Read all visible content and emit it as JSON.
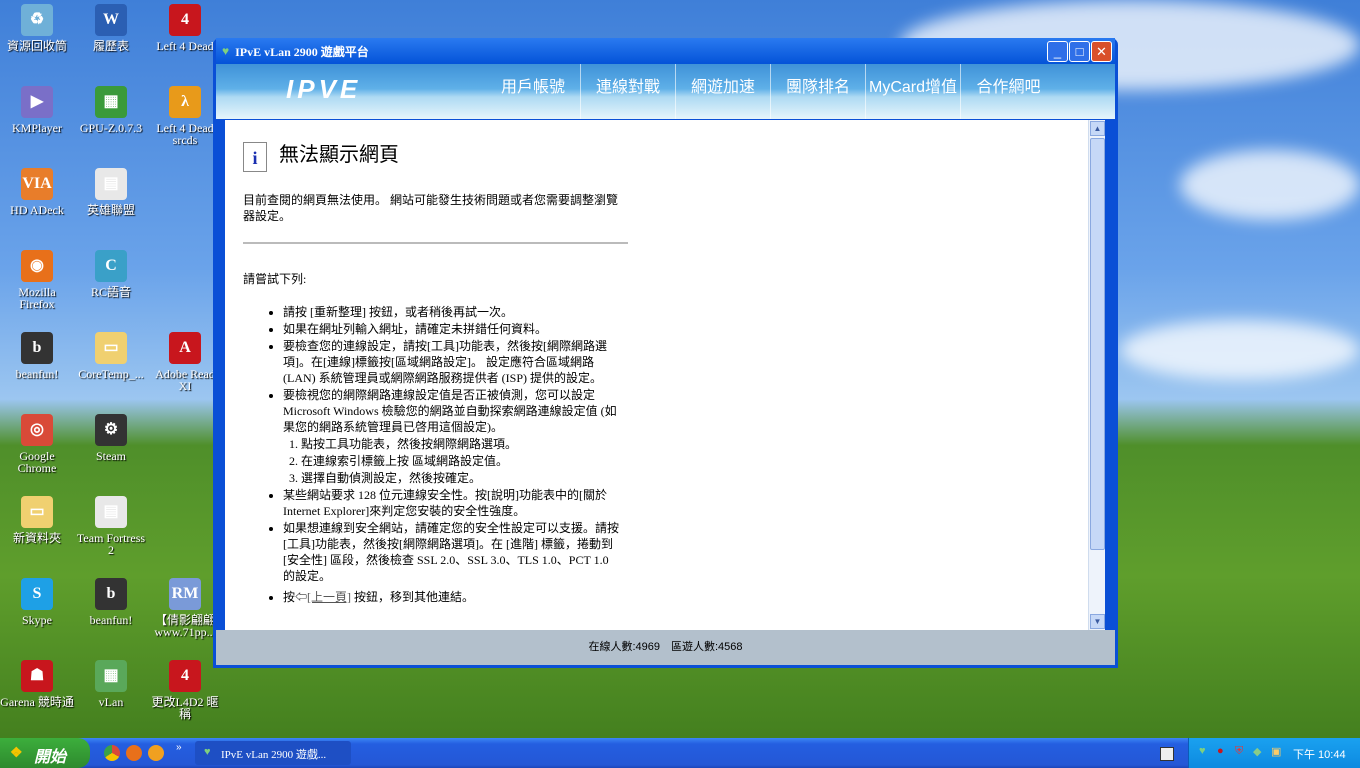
{
  "desktop": {
    "icons": [
      {
        "label": "資源回收筒",
        "glyph": "♻",
        "color": "#6fb0d8"
      },
      {
        "label": "KMPlayer",
        "glyph": "▶",
        "color": "#7a6fc8"
      },
      {
        "label": "HD ADeck",
        "glyph": "VIA",
        "color": "#e87d2a"
      },
      {
        "label": "Mozilla Firefox",
        "glyph": "◉",
        "color": "#e8701a"
      },
      {
        "label": "beanfun!",
        "glyph": "b",
        "color": "#333"
      },
      {
        "label": "Google Chrome",
        "glyph": "◎",
        "color": "#d94a38"
      },
      {
        "label": "新資料夾",
        "glyph": "▭",
        "color": "#f0d070"
      },
      {
        "label": "Skype",
        "glyph": "S",
        "color": "#1ea0e6"
      },
      {
        "label": "Garena 競時通",
        "glyph": "☗",
        "color": "#c8161d"
      },
      {
        "label": "履歷表",
        "glyph": "W",
        "color": "#2b5fb3"
      },
      {
        "label": "GPU-Z.0.7.3",
        "glyph": "▦",
        "color": "#3a9a3a"
      },
      {
        "label": "英雄聯盟",
        "glyph": "▤",
        "color": "#e8e8e8"
      },
      {
        "label": "RC語音",
        "glyph": "C",
        "color": "#3aa0c8"
      },
      {
        "label": "CoreTemp_...",
        "glyph": "▭",
        "color": "#f0d070"
      },
      {
        "label": "Steam",
        "glyph": "⚙",
        "color": "#333"
      },
      {
        "label": "Team Fortress 2",
        "glyph": "▤",
        "color": "#e8e8e8"
      },
      {
        "label": "beanfun!",
        "glyph": "b",
        "color": "#333"
      },
      {
        "label": "vLan",
        "glyph": "▦",
        "color": "#5aa85a"
      },
      {
        "label": "Left 4 Dead",
        "glyph": "4",
        "color": "#c8161d"
      },
      {
        "label": "Left 4 Dead srcds",
        "glyph": "λ",
        "color": "#e89a1a"
      },
      {
        "label": "Adobe Read XI",
        "glyph": "A",
        "color": "#c8161d"
      },
      {
        "label": "【倩影翩翩 www.71pp...",
        "glyph": "RM",
        "color": "#7a9ad8"
      },
      {
        "label": "更改L4D2 暱稱",
        "glyph": "4",
        "color": "#c8161d"
      }
    ]
  },
  "window": {
    "title": "IPvE vLan 2900 遊戲平台",
    "logo": "IPVE",
    "nav": [
      "用戶帳號",
      "連線對戰",
      "網遊加速",
      "團隊排名",
      "MyCard增值",
      "合作網吧"
    ],
    "page": {
      "heading": "無法顯示網頁",
      "intro": "目前查閱的網頁無法使用。 網站可能發生技術問題或者您需要調整瀏覽器設定。",
      "try": "請嘗試下列:",
      "items": [
        "請按 [重新整理] 按鈕，或者稍後再試一次。",
        "如果在網址列輸入網址，請確定未拼錯任何資料。",
        "要檢查您的連線設定，請按[工具]功能表，然後按[網際網路選項]。在[連線]標籤按[區域網路設定]。 設定應符合區域網路 (LAN) 系統管理員或網際網路服務提供者 (ISP) 提供的設定。",
        "要檢視您的網際網路連線設定值是否正被偵測，您可以設定 Microsoft Windows 檢驗您的網路並自動探索網路連線設定值 (如果您的網路系統管理員已啓用這個設定)。",
        "某些網站要求 128 位元連線安全性。按[說明]功能表中的[關於 Internet Explorer]來判定您安裝的安全性強度。",
        "如果想連線到安全網站，請確定您的安全性設定可以支援。請按[工具]功能表，然後按[網際網路選項]。在 [進階] 標籤，捲動到 [安全性] 區段，然後檢查 SSL 2.0、SSL 3.0、TLS 1.0、PCT 1.0 的設定。"
      ],
      "steps": [
        "點按工具功能表，然後按網際網路選項。",
        "在連線索引標籤上按 區域網路設定值。",
        "選擇自動偵測設定，然後按確定。"
      ],
      "back_prefix": "按",
      "back_link": "[上一頁]",
      "back_suffix": " 按鈕，移到其他連結。"
    },
    "status": "在線人數:4969　區遊人數:4568"
  },
  "taskbar": {
    "start": "開始",
    "task": "IPvE vLan 2900 遊戲...",
    "clock": "下午 10:44"
  }
}
